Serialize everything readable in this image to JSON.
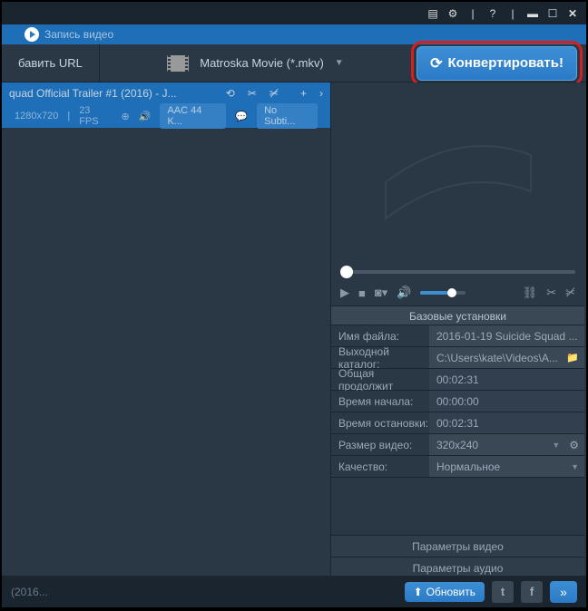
{
  "titlebar": {
    "record_label": "Запись видео"
  },
  "toolbar": {
    "add_url_label": "бавить URL",
    "format_text": "Matroska Movie (*.mkv)",
    "convert_label": "Конвертировать!"
  },
  "track": {
    "title": "quad Official Trailer #1 (2016) - J...",
    "resolution": "1280x720",
    "fps": "23 FPS",
    "audio": "AAC 44 K...",
    "subtitle": "No Subti..."
  },
  "settings": {
    "header": "Базовые установки",
    "rows": [
      {
        "label": "Имя файла:",
        "value": "2016-01-19 Suicide Squad ..."
      },
      {
        "label": "Выходной каталог:",
        "value": "C:\\Users\\kate\\Videos\\A..."
      },
      {
        "label": "Общая продолжит",
        "value": "00:02:31"
      },
      {
        "label": "Время начала:",
        "value": "00:00:00"
      },
      {
        "label": "Время остановки:",
        "value": "00:02:31"
      },
      {
        "label": "Размер видео:",
        "value": "320x240"
      },
      {
        "label": "Качество:",
        "value": "Нормальное"
      }
    ],
    "video_params": "Параметры видео",
    "audio_params": "Параметры аудио"
  },
  "footer": {
    "status": "(2016...",
    "update_label": "Обновить"
  }
}
